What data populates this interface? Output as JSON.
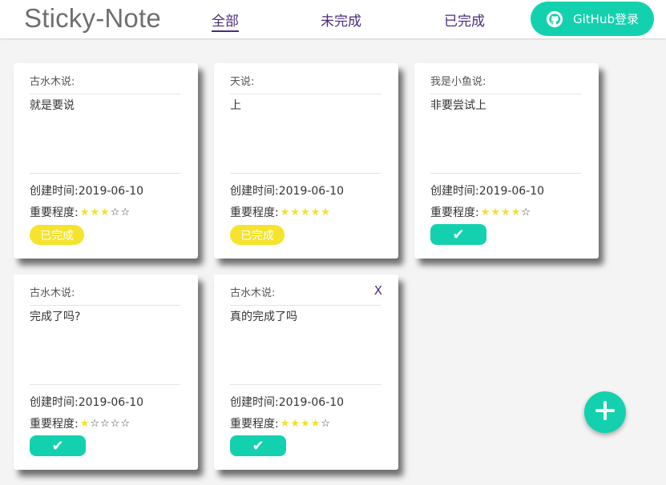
{
  "header": {
    "logo": "Sticky-Note",
    "tabs": [
      {
        "label": "全部"
      },
      {
        "label": "未完成"
      },
      {
        "label": "已完成"
      }
    ],
    "login_label": "GitHub登录",
    "login_icon": "github-icon"
  },
  "cards": [
    {
      "author": "古水木说:",
      "content": "就是要说",
      "time": "创建时间:2019-06-10",
      "importance_label": "重要程度:",
      "stars": 3,
      "status": "已完成",
      "closable": false
    },
    {
      "author": "天说:",
      "content": "上",
      "time": "创建时间:2019-06-10",
      "importance_label": "重要程度:",
      "stars": 5,
      "status": "已完成",
      "closable": false
    },
    {
      "author": "我是小鱼说:",
      "content": "非要尝试上",
      "time": "创建时间:2019-06-10",
      "importance_label": "重要程度:",
      "stars": 4,
      "status": "✔",
      "closable": false
    },
    {
      "author": "古水木说:",
      "content": "完成了吗?",
      "time": "创建时间:2019-06-10",
      "importance_label": "重要程度:",
      "stars": 1,
      "status": "✔",
      "closable": false
    },
    {
      "author": "古水木说:",
      "content": "真的完成了吗",
      "time": "创建时间:2019-06-10",
      "importance_label": "重要程度:",
      "stars": 4,
      "status": "✔",
      "closable": true,
      "close_label": "X"
    }
  ],
  "max_stars": 5,
  "fab_icon": "plus-icon",
  "colors": {
    "accent": "#13d1ae",
    "done": "#f5e32d",
    "star": "#f3e02a",
    "tab": "#4b2b7f"
  }
}
